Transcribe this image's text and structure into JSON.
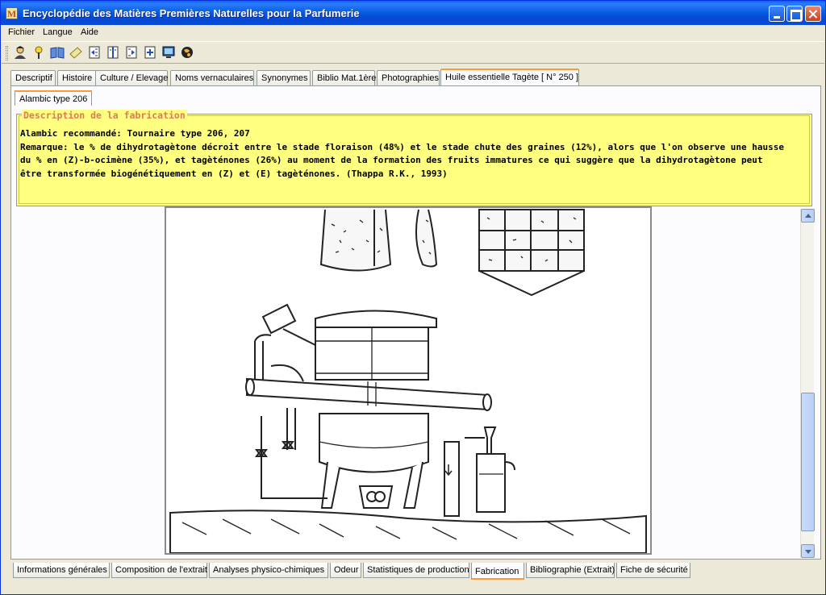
{
  "window": {
    "title": "Encyclopédie des Matières Premières Naturelles pour la Parfumerie",
    "app_icon_letter": "M"
  },
  "menu": [
    "Fichier",
    "Langue",
    "Aide"
  ],
  "toolbar_icons": [
    "user-icon",
    "pin-icon",
    "book-icon",
    "note-icon",
    "page-prev-icon",
    "page-split-icon",
    "page-next-icon",
    "page-add-icon",
    "monitor-icon",
    "globe-icon"
  ],
  "top_tabs": [
    "Descriptif",
    "Histoire",
    "Culture / Elevage",
    "Noms vernaculaires",
    "Synonymes",
    "Biblio Mat.1ère",
    "Photographies",
    "Huile essentielle Tagète [ N° 250 ]"
  ],
  "active_top_tab": 7,
  "sub_tab": "Alambic type 206",
  "description": {
    "legend": "Description de la fabrication",
    "lines": [
      "Alambic recommandé: Tournaire type 206, 207",
      "Remarque: le % de dihydrotagètone décroit entre le stade floraison (48%) et le stade chute des graines (12%), alors que l'on observe une hausse",
      "du % en (Z)-b-ocimène (35%), et tagèténones (26%) au moment de la formation des fruits immatures ce qui suggère que la dihydrotagètone peut",
      "être transformée biogénétiquement en (Z) et (E) tagèténones. (Thappa R.K., 1993)"
    ]
  },
  "bottom_tabs": [
    "Informations générales",
    "Composition de l'extrait",
    "Analyses physico-chimiques",
    "Odeur",
    "Statistiques de production",
    "Fabrication",
    "Bibliographie (Extrait)",
    "Fiche de sécurité"
  ],
  "active_bottom_tab": 5,
  "colors": {
    "description_bg": "#ffff80",
    "legend": "#e3775a",
    "active_tab_accent": "#ff9933",
    "titlebar": "#0a5fe3"
  }
}
